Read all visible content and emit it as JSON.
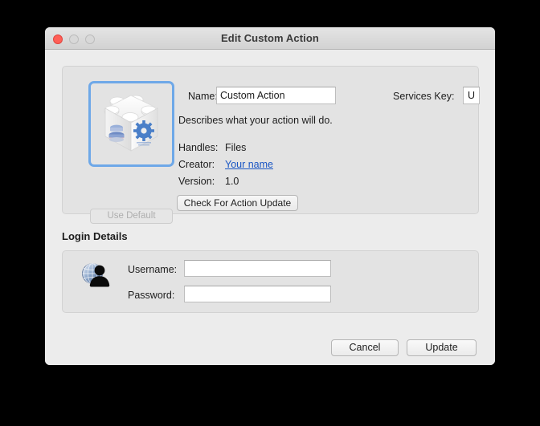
{
  "window": {
    "title": "Edit Custom Action",
    "traffic_lights": {
      "close": "close-button",
      "minimize": "minimize-button",
      "zoom": "zoom-button"
    }
  },
  "action_panel": {
    "icon": {
      "name": "custom-action-brick-icon",
      "description": "white lego brick with blue gear"
    },
    "use_default_label": "Use Default",
    "name_label": "Name:",
    "name_value": "Custom Action",
    "services_key_label": "Services Key:",
    "services_key_value": "U",
    "description": "Describes what your action will do.",
    "handles_label": "Handles:",
    "handles_value": "Files",
    "creator_label": "Creator:",
    "creator_value": "Your name",
    "version_label": "Version:",
    "version_value": "1.0",
    "check_update_label": "Check For Action Update"
  },
  "login_panel": {
    "section_title": "Login Details",
    "icon": {
      "name": "user-globe-icon"
    },
    "username_label": "Username:",
    "username_value": "",
    "password_label": "Password:",
    "password_value": ""
  },
  "footer": {
    "cancel_label": "Cancel",
    "update_label": "Update"
  },
  "colors": {
    "accent_blue": "#6ea8e8",
    "link_blue": "#1a56c4",
    "window_bg": "#ececec",
    "panel_bg": "#e3e3e3",
    "close_red": "#ff5f57"
  }
}
